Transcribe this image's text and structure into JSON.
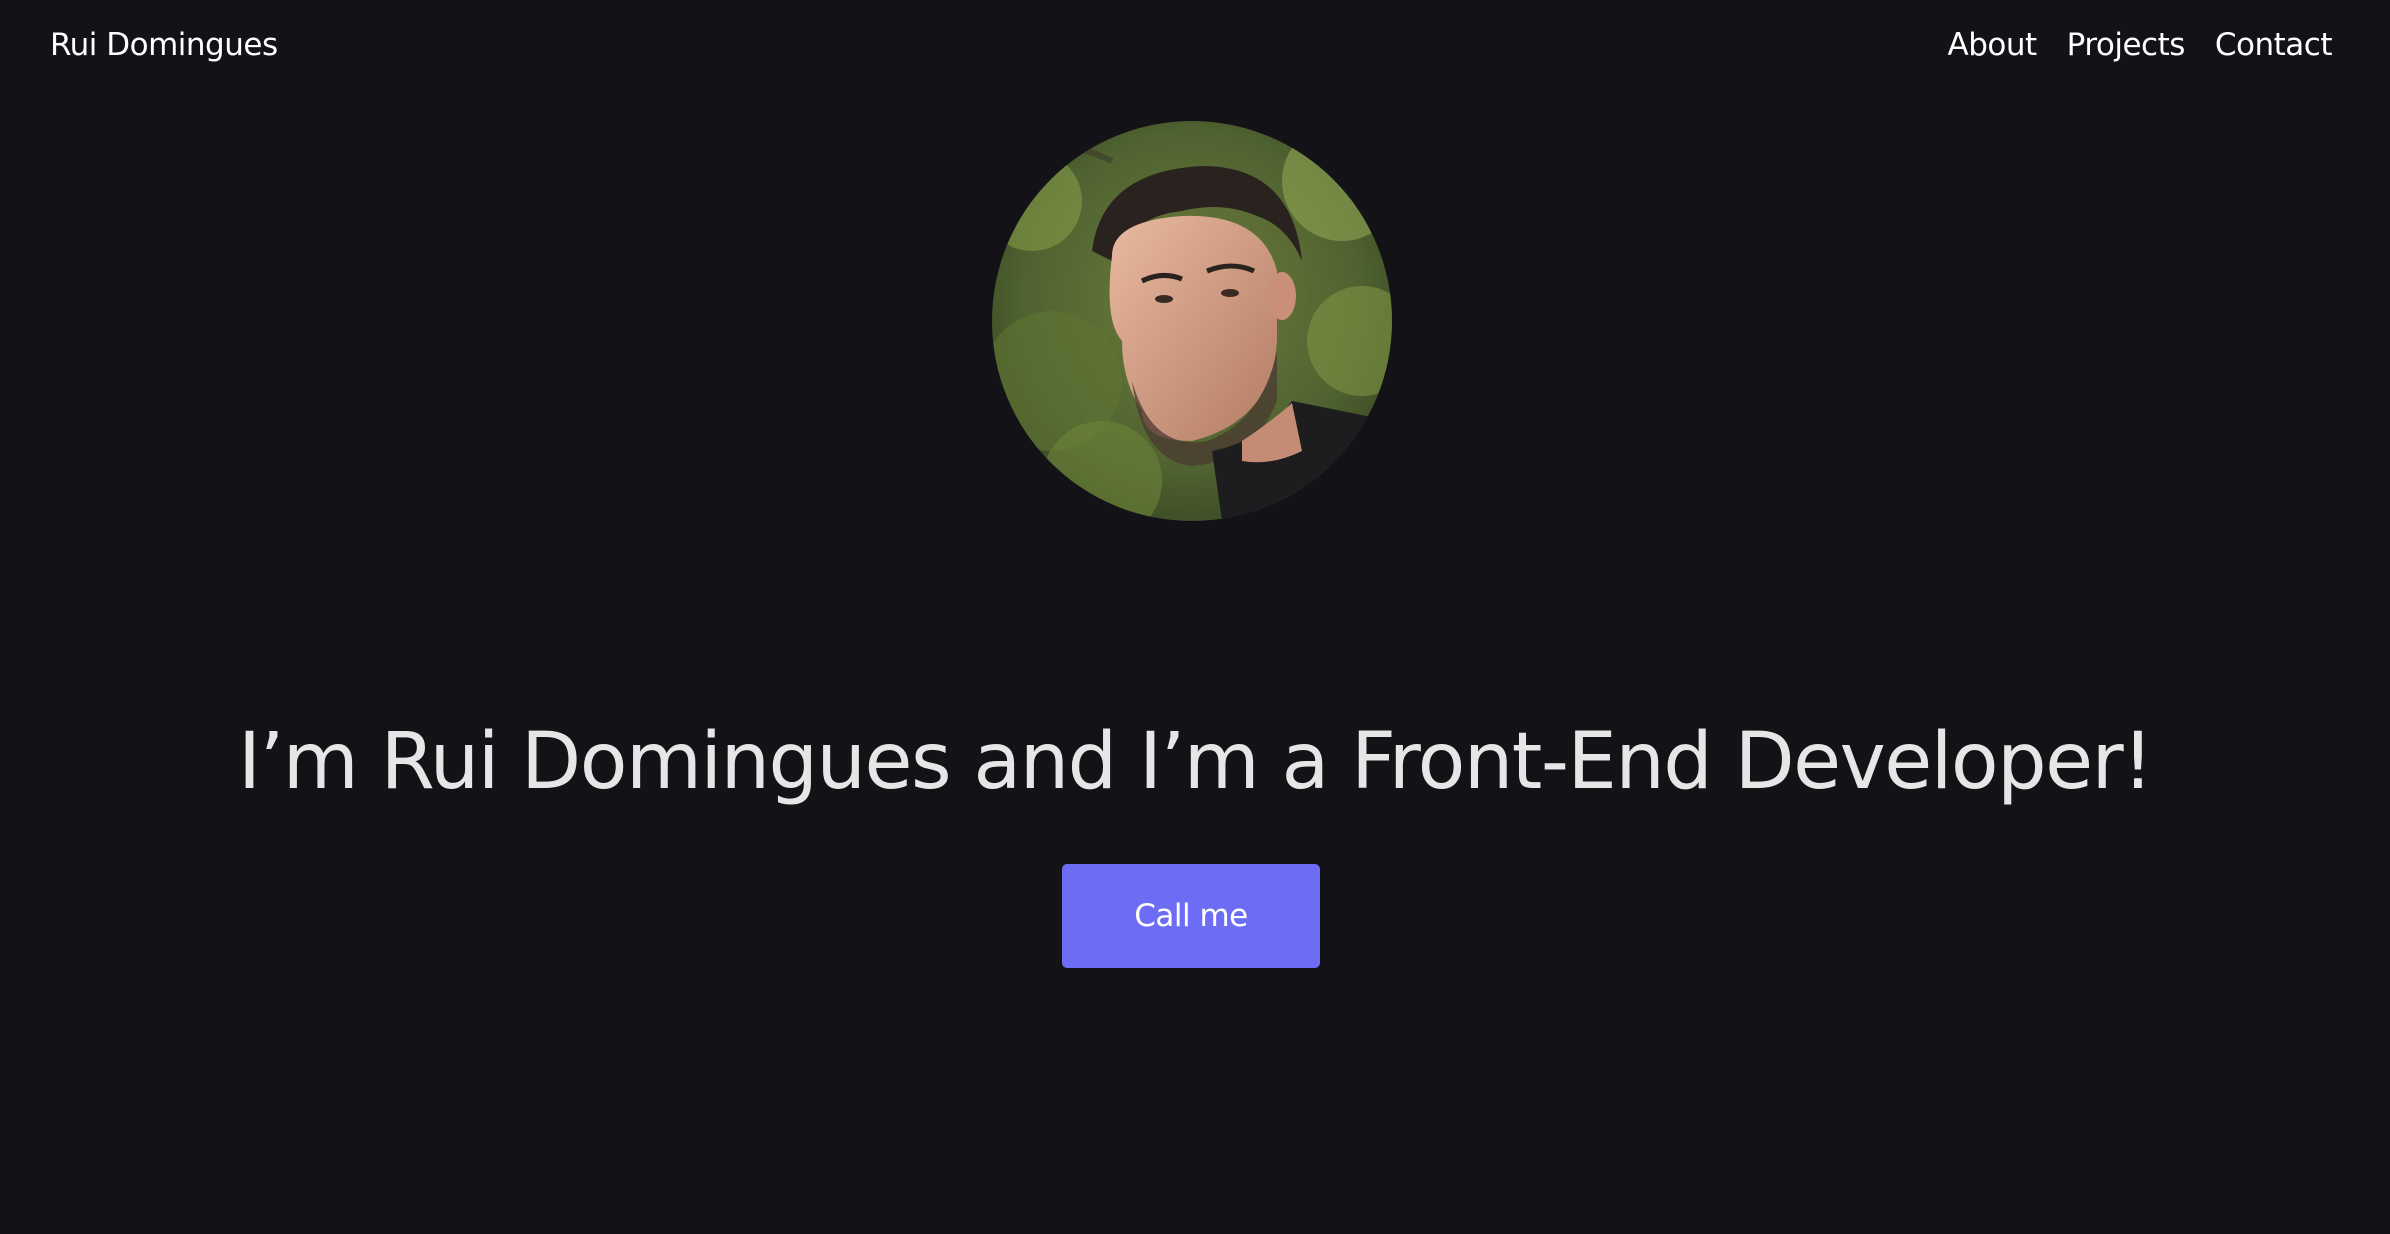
{
  "nav": {
    "brand": "Rui Domingues",
    "links": [
      {
        "label": "About"
      },
      {
        "label": "Projects"
      },
      {
        "label": "Contact"
      }
    ]
  },
  "hero": {
    "avatar_icon": "profile-photo",
    "headline": "I’m Rui Domingues and I’m a Front-End Developer!",
    "cta_label": "Call me"
  },
  "colors": {
    "background": "#121217",
    "text": "#ffffff",
    "headline": "#e6e6e6",
    "accent": "#6c6cf5"
  }
}
